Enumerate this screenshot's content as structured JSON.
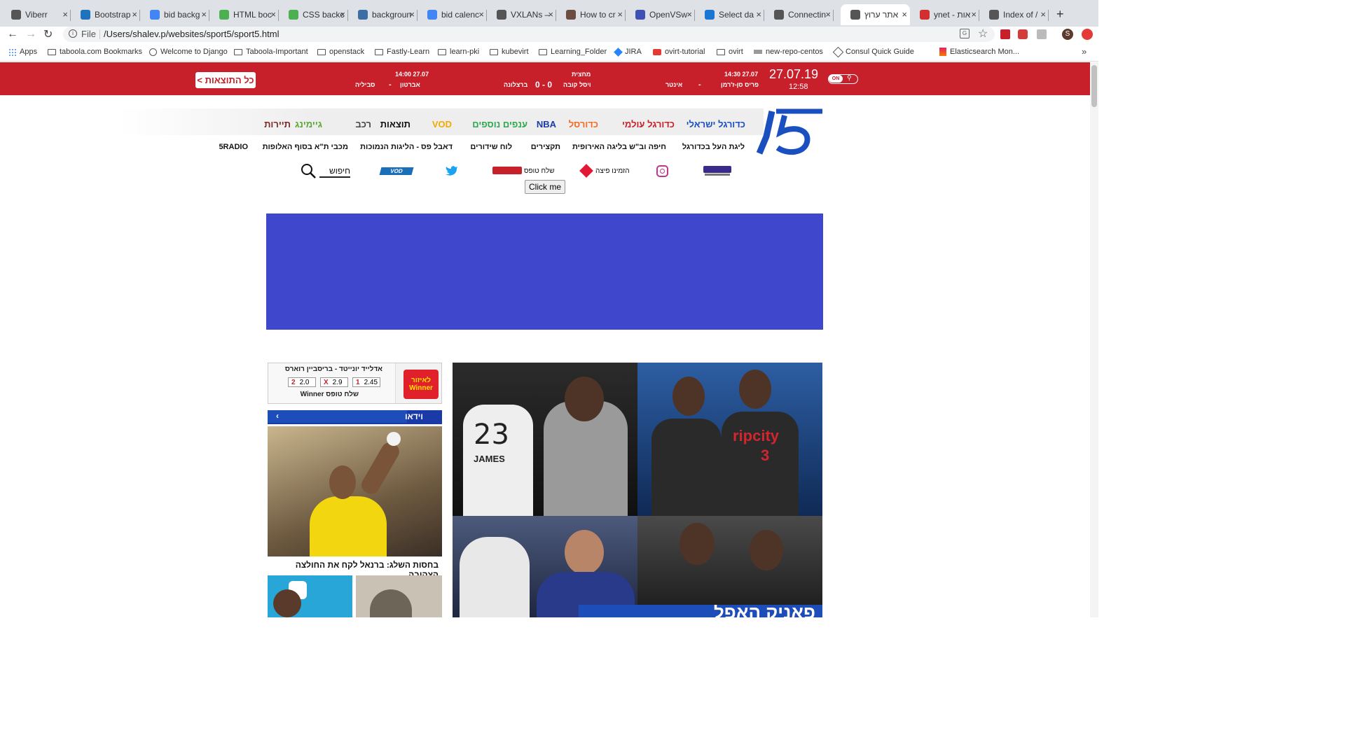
{
  "browser": {
    "tabs": [
      {
        "title": "Viberr",
        "color": "#555"
      },
      {
        "title": "Bootstrap",
        "color": "#1e73be"
      },
      {
        "title": "bid backg",
        "color": "#4285f4"
      },
      {
        "title": "HTML boc",
        "color": "#4caf50"
      },
      {
        "title": "CSS backc",
        "color": "#4caf50"
      },
      {
        "title": "backgroun",
        "color": "#3b6ea5"
      },
      {
        "title": "bid calenc",
        "color": "#4285f4"
      },
      {
        "title": "VXLANs –",
        "color": "#555"
      },
      {
        "title": "How to cr",
        "color": "#6d4c41"
      },
      {
        "title": "OpenVSw",
        "color": "#3f51b5"
      },
      {
        "title": "Select da",
        "color": "#1976d2"
      },
      {
        "title": "Connectin",
        "color": "#555"
      },
      {
        "title": "אתר ערוץ",
        "color": "#555",
        "active": true
      },
      {
        "title": "ynet - אות",
        "color": "#d32f2f"
      },
      {
        "title": "Index of /",
        "color": "#555"
      }
    ],
    "address_prefix": "File",
    "address": "/Users/shalev.p/websites/sport5/sport5.html",
    "profile_initial": "S",
    "bookmarks": [
      "Apps",
      "taboola.com Bookmarks",
      "Welcome to Django",
      "Taboola-Important",
      "openstack",
      "Fastly-Learn",
      "learn-pki",
      "kubevirt",
      "Learning_Folder",
      "JIRA",
      "ovirt-tutorial",
      "ovirt",
      "new-repo-centos",
      "Consul Quick Guide",
      "Elasticsearch Mon..."
    ],
    "bookmarks_more": "»"
  },
  "scorebar": {
    "date": "27.07.19",
    "time": "12:58",
    "toggle_label": "ON",
    "all_results": "כל התוצאות >",
    "match1": {
      "time": "27.07 14:30",
      "home": "פריס סן-ז'רמן",
      "away": "אינטר",
      "score": "-"
    },
    "match2": {
      "status": "מחצית",
      "home": "ויסל קובה",
      "away": "ברצלונה",
      "score": "0 - 0"
    },
    "match3": {
      "time": "27.07 14:00",
      "home": "אברטון",
      "away": "סביליה",
      "score": "-"
    }
  },
  "nav": {
    "main": [
      {
        "label": "כדורגל ישראלי",
        "color": "#1a4fc0"
      },
      {
        "label": "כדורגל עולמי",
        "color": "#c8202a"
      },
      {
        "label": "כדורסל",
        "color": "#f26b21"
      },
      {
        "label": "NBA",
        "color": "#1a3aa8"
      },
      {
        "label": "ענפים נוספים",
        "color": "#2fa84f"
      },
      {
        "label": "VOD",
        "color": "#f2a900"
      },
      {
        "label": "תוצאות",
        "color": "#111111"
      },
      {
        "label": "רכב",
        "color": "#444444"
      },
      {
        "label": "גיימינג",
        "color": "#5aa832"
      },
      {
        "label": "תיירות",
        "color": "#7a2a2a"
      }
    ],
    "sub": [
      "ליגת העל בכדורגל",
      "חיפה וב\"ש בליגה האירופית",
      "תקצירים",
      "לוח שידורים",
      "דאבל פס - הליגות הנמוכות",
      "מכבי ת\"א בסוף האלופות",
      "5RADIO"
    ],
    "icons": {
      "pizza_label": "הזמינו פיצה",
      "toto_label": "שלח טופס",
      "vod_label": "VOD",
      "search_placeholder": "חיפוש"
    },
    "click_me": "Click me"
  },
  "winner": {
    "match": "אדלייד יונייטד - בריסביין רוארס",
    "odds": [
      {
        "key": "1",
        "val": "2.45"
      },
      {
        "key": "X",
        "val": "2.9"
      },
      {
        "key": "2",
        "val": "2.0"
      }
    ],
    "cta": "שלח טופס Winner",
    "logo": "לאיזור Winner"
  },
  "video": {
    "header": "וידאו",
    "caption": "בחסות השלג: ברנאל לקח את החולצה הצהובה"
  },
  "hero": {
    "jersey_left": "23",
    "name_left": "JAMES",
    "jersey_right": "3",
    "team_text": "ripcity",
    "headline_partial": "פאניק האפל"
  }
}
